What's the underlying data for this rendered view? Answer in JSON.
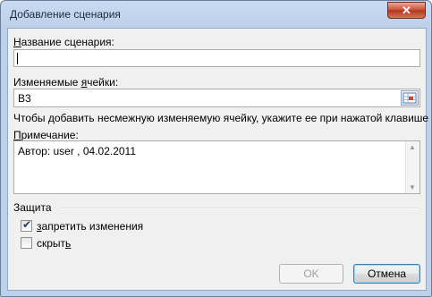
{
  "window": {
    "title": "Добавление сценария",
    "close_label": "✕"
  },
  "scenario_name": {
    "label": "Название сценария:",
    "value": ""
  },
  "changing_cells": {
    "label": "Изменяемые ячейки:",
    "value": "B3",
    "hint": "Чтобы добавить несмежную изменяемую ячейку, укажите ее при нажатой клавише Ctrl."
  },
  "comment": {
    "label": "Примечание:",
    "value": "Автор: user , 04.02.2011"
  },
  "protection": {
    "label": "Защита",
    "prevent_changes": {
      "label": "запретить изменения",
      "checked": true
    },
    "hide": {
      "label": "скрыть",
      "checked": false
    }
  },
  "buttons": {
    "ok": "OK",
    "cancel": "Отмена"
  }
}
